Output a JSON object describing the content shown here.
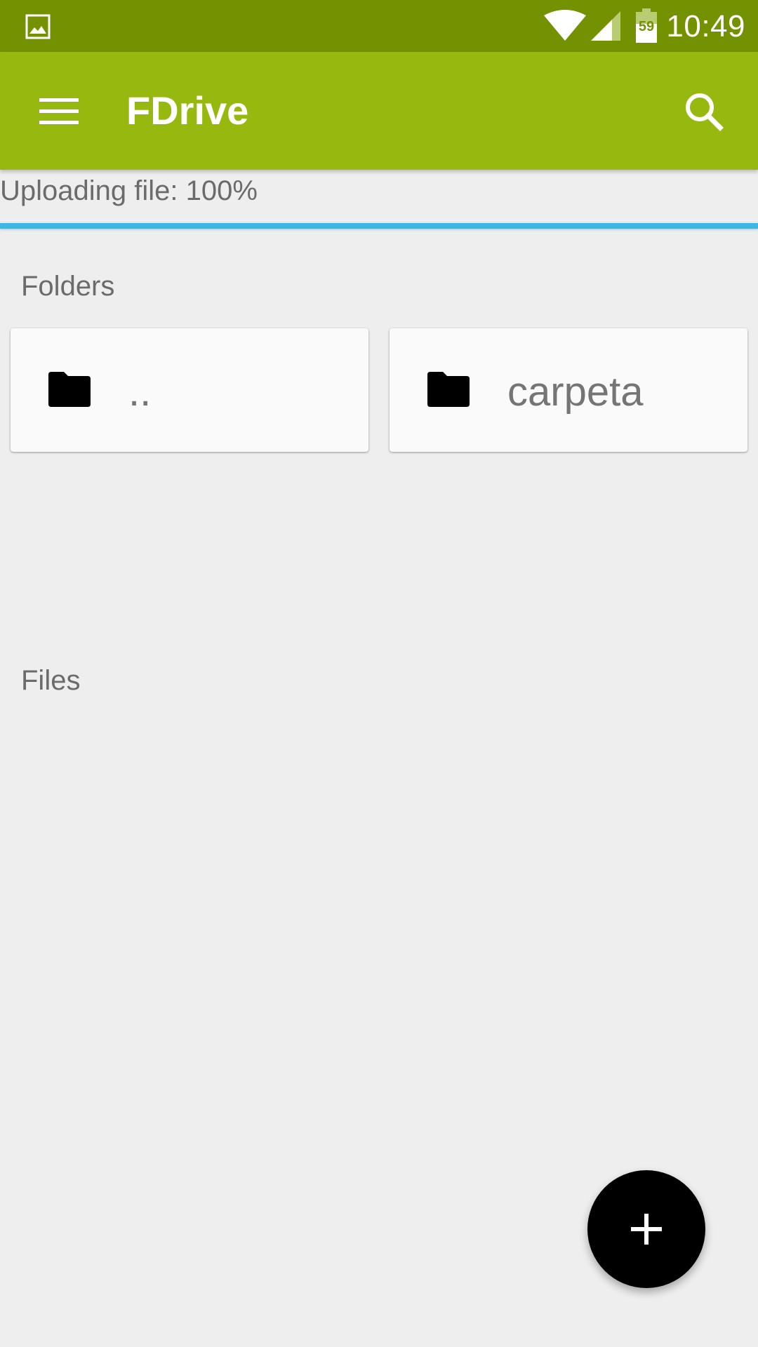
{
  "status_bar": {
    "time": "10:49",
    "battery_level": "59",
    "icons": [
      "gallery-icon",
      "wifi-icon",
      "signal-icon",
      "battery-icon"
    ]
  },
  "app_bar": {
    "title": "FDrive",
    "menu_icon": "menu-icon",
    "search_icon": "search-icon",
    "color": "#97b90f",
    "status_color": "#739101"
  },
  "upload": {
    "label": "Uploading file: 100%",
    "progress": 1.0,
    "color": "#3fb6e2"
  },
  "folders": {
    "label": "Folders",
    "items": [
      {
        "name": "..",
        "icon": "folder-icon"
      },
      {
        "name": "carpeta",
        "icon": "folder-icon"
      }
    ]
  },
  "files": {
    "label": "Files",
    "items": []
  },
  "fab": {
    "icon": "plus-icon"
  }
}
